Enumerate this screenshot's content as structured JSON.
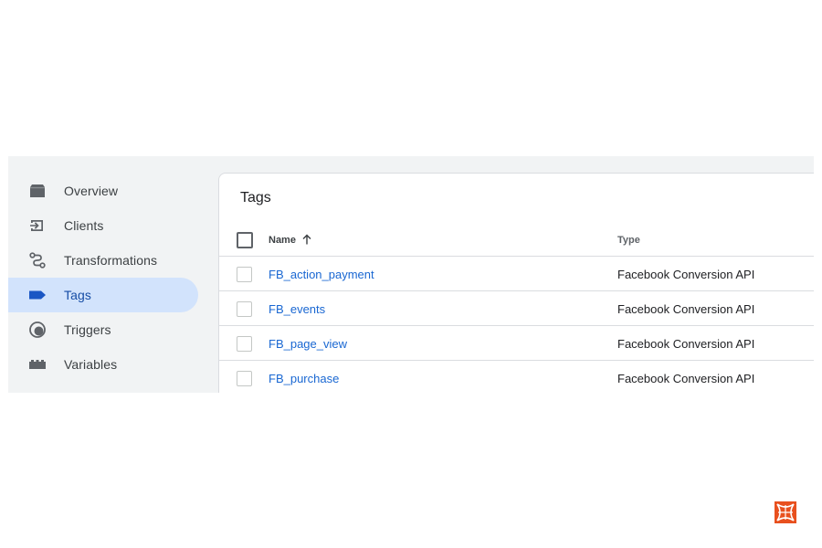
{
  "sidebar": {
    "items": [
      {
        "label": "Overview",
        "icon": "overview-icon"
      },
      {
        "label": "Clients",
        "icon": "clients-icon"
      },
      {
        "label": "Transformations",
        "icon": "transformations-icon"
      },
      {
        "label": "Tags",
        "icon": "tag-icon",
        "active": true
      },
      {
        "label": "Triggers",
        "icon": "triggers-icon"
      },
      {
        "label": "Variables",
        "icon": "variables-icon"
      }
    ]
  },
  "main": {
    "title": "Tags",
    "table": {
      "columns": [
        "Name",
        "Type"
      ],
      "sort_icon": "arrow-up-icon",
      "rows": [
        {
          "name": "FB_action_payment",
          "type": "Facebook Conversion API"
        },
        {
          "name": "FB_events",
          "type": "Facebook Conversion API"
        },
        {
          "name": "FB_page_view",
          "type": "Facebook Conversion API"
        },
        {
          "name": "FB_purchase",
          "type": "Facebook Conversion API"
        }
      ]
    }
  },
  "colors": {
    "active_bg": "#d2e3fc",
    "link": "#1967d2",
    "icon": "#5f6368",
    "logo": "#e8501e"
  }
}
